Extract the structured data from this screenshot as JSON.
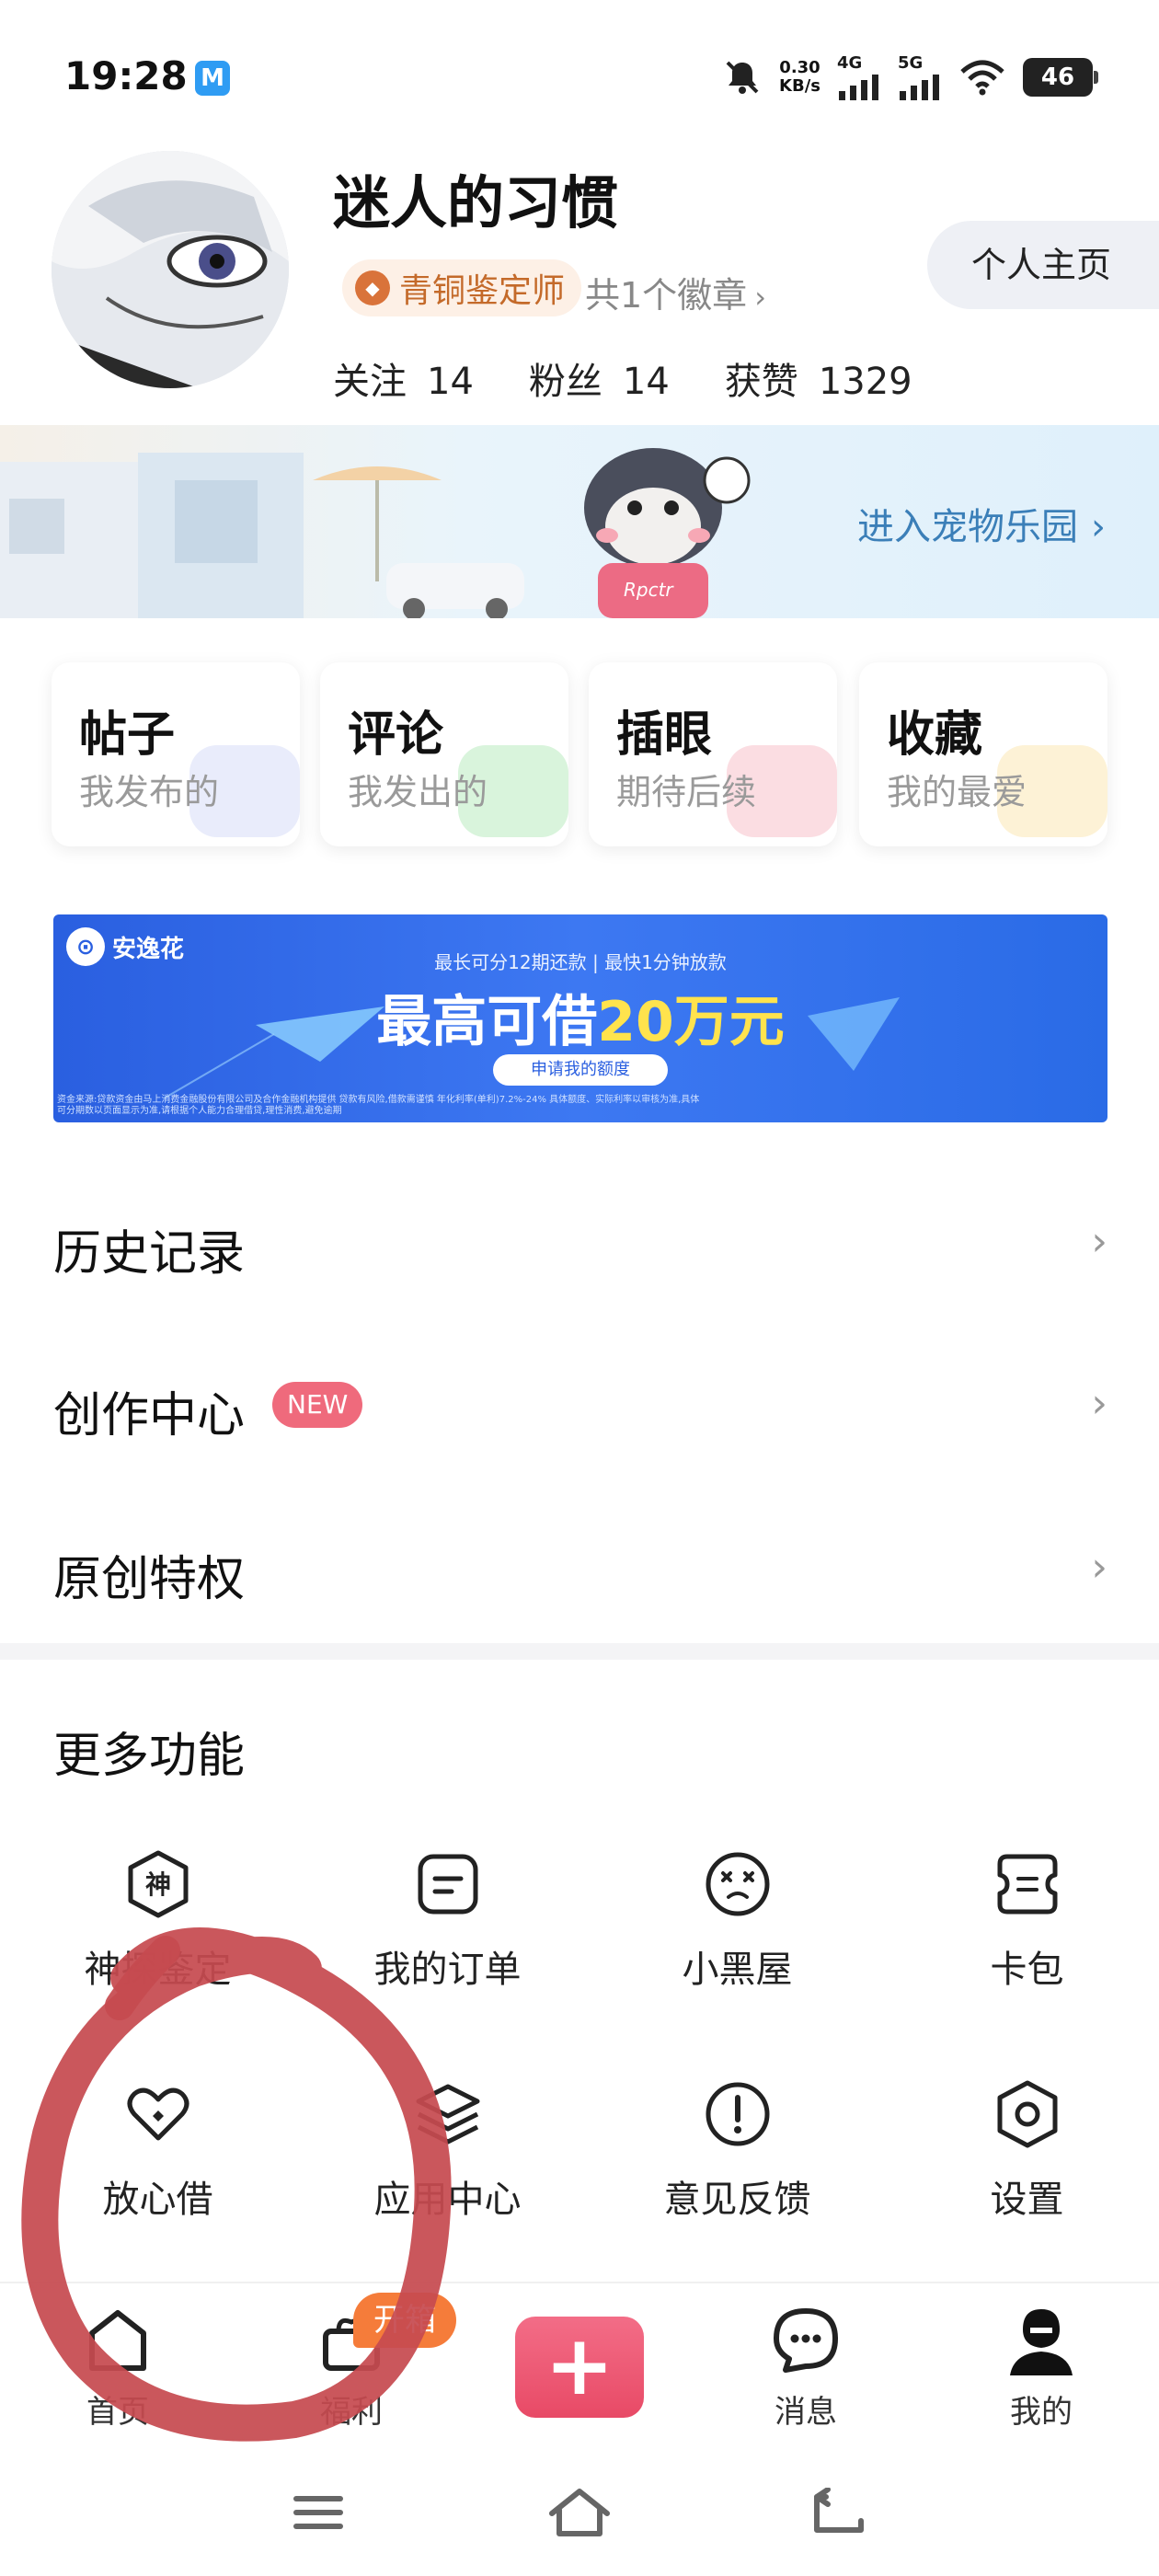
{
  "status_bar": {
    "time": "19:28",
    "app_icon_letter": "M",
    "net_speed_value": "0.30",
    "net_speed_unit": "KB/s",
    "signal_1": "4G",
    "signal_2": "5G",
    "battery": "46"
  },
  "profile": {
    "username": "迷人的习惯",
    "badge_label": "青铜鉴定师",
    "badge_count": "共1个徽章",
    "stats": [
      {
        "label": "关注",
        "value": "14"
      },
      {
        "label": "粉丝",
        "value": "14"
      },
      {
        "label": "获赞",
        "value": "1329"
      }
    ],
    "homepage_button": "个人主页"
  },
  "pet_banner": {
    "link_text": "进入宠物乐园",
    "mascot_shirt_text": "Rpctr"
  },
  "quick_cards": [
    {
      "title": "帖子",
      "subtitle": "我发布的",
      "deco_color": "#e9ecfb"
    },
    {
      "title": "评论",
      "subtitle": "我发出的",
      "deco_color": "#d9f4dc"
    },
    {
      "title": "插眼",
      "subtitle": "期待后续",
      "deco_color": "#fbdde2"
    },
    {
      "title": "收藏",
      "subtitle": "我的最爱",
      "deco_color": "#fdf2d6"
    }
  ],
  "ad_banner": {
    "brand": "安逸花",
    "subtitle": "最长可分12期还款 | 最快1分钟放款",
    "title_prefix": "最高可借",
    "title_highlight": "20万元",
    "button": "申请我的额度",
    "disclaimer": "资金来源:贷款资金由马上消费金融股份有限公司及合作金融机构提供 贷款有风险,借款需谨慎 年化利率(单利)7.2%-24% 具体额度、实际利率以审核为准,具体可分期数以页面显示为准,请根据个人能力合理借贷,理性消费,避免逾期"
  },
  "list_rows": [
    {
      "label": "历史记录",
      "badge": ""
    },
    {
      "label": "创作中心",
      "badge": "NEW"
    },
    {
      "label": "原创特权",
      "badge": ""
    }
  ],
  "more_section": {
    "title": "更多功能",
    "items": [
      {
        "label": "神探鉴定",
        "icon": "shen-hexagon-icon"
      },
      {
        "label": "我的订单",
        "icon": "order-list-icon"
      },
      {
        "label": "小黑屋",
        "icon": "dizzy-face-icon"
      },
      {
        "label": "卡包",
        "icon": "card-wallet-icon"
      },
      {
        "label": "放心借",
        "icon": "loan-hearts-icon"
      },
      {
        "label": "应用中心",
        "icon": "layers-icon"
      },
      {
        "label": "意见反馈",
        "icon": "exclamation-circle-icon"
      },
      {
        "label": "设置",
        "icon": "settings-hexagon-icon"
      }
    ]
  },
  "bottom_nav": {
    "items": [
      {
        "label": "首页",
        "icon": "home-icon"
      },
      {
        "label": "福利",
        "icon": "gift-icon"
      },
      {
        "label": "",
        "icon": "plus-icon"
      },
      {
        "label": "消息",
        "icon": "message-bubble-icon"
      },
      {
        "label": "我的",
        "icon": "profile-icon"
      }
    ],
    "gift_badge": "开箱"
  },
  "colors": {
    "accent_pink": "#e84a66",
    "badge_orange": "#f57c3a",
    "link_blue": "#3b7fb8",
    "annotation_red": "#c64a50"
  }
}
